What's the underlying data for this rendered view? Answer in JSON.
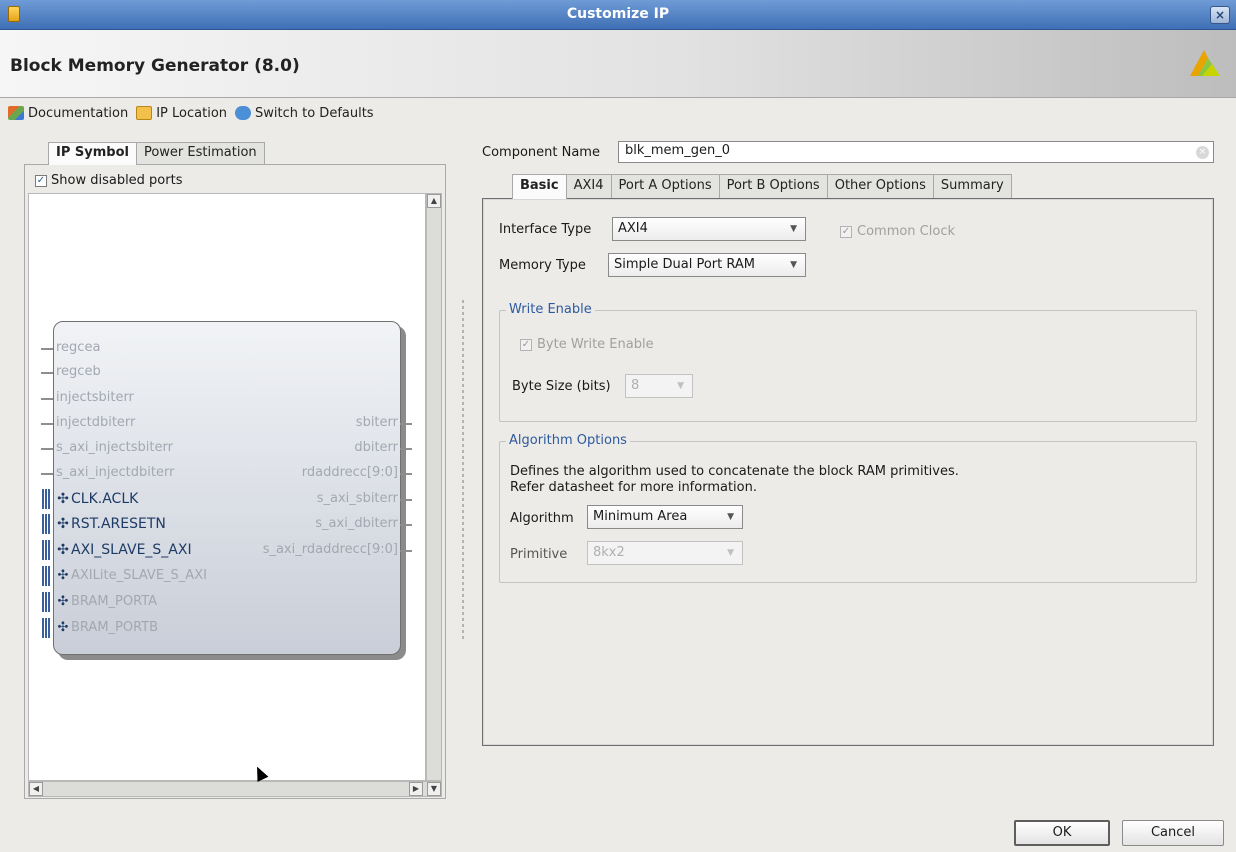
{
  "window": {
    "title": "Customize IP",
    "close_label": "×"
  },
  "header": {
    "ip_name": "Block Memory Generator (8.0)",
    "logo_icon": "vivado-logo-icon"
  },
  "toolbar": {
    "documentation": "Documentation",
    "ip_location": "IP Location",
    "switch_to_defaults": "Switch to Defaults"
  },
  "left_panel": {
    "tabs": [
      {
        "label": "IP Symbol",
        "active": true
      },
      {
        "label": "Power Estimation",
        "active": false
      }
    ],
    "show_disabled_ports": {
      "label": "Show disabled ports",
      "checked": true
    },
    "symbol": {
      "left_ports": [
        {
          "name": "regcea",
          "enabled": false,
          "bus": false
        },
        {
          "name": "regceb",
          "enabled": false,
          "bus": false
        },
        {
          "name": "injectsbiterr",
          "enabled": false,
          "bus": false
        },
        {
          "name": "injectdbiterr",
          "enabled": false,
          "bus": false
        },
        {
          "name": "s_axi_injectsbiterr",
          "enabled": false,
          "bus": false
        },
        {
          "name": "s_axi_injectdbiterr",
          "enabled": false,
          "bus": false
        },
        {
          "name": "CLK.ACLK",
          "enabled": true,
          "bus": true
        },
        {
          "name": "RST.ARESETN",
          "enabled": true,
          "bus": true
        },
        {
          "name": "AXI_SLAVE_S_AXI",
          "enabled": true,
          "bus": true
        },
        {
          "name": "AXILite_SLAVE_S_AXI",
          "enabled": false,
          "bus": true
        },
        {
          "name": "BRAM_PORTA",
          "enabled": false,
          "bus": true
        },
        {
          "name": "BRAM_PORTB",
          "enabled": false,
          "bus": true
        }
      ],
      "right_ports": [
        {
          "name": "sbiterr"
        },
        {
          "name": "dbiterr"
        },
        {
          "name": "rdaddrecc[9:0]"
        },
        {
          "name": "s_axi_sbiterr"
        },
        {
          "name": "s_axi_dbiterr"
        },
        {
          "name": "s_axi_rdaddrecc[9:0]"
        }
      ]
    }
  },
  "component": {
    "label": "Component Name",
    "value": "blk_mem_gen_0"
  },
  "right_tabs": [
    {
      "label": "Basic",
      "active": true
    },
    {
      "label": "AXI4",
      "active": false
    },
    {
      "label": "Port A Options",
      "active": false
    },
    {
      "label": "Port B Options",
      "active": false
    },
    {
      "label": "Other Options",
      "active": false
    },
    {
      "label": "Summary",
      "active": false
    }
  ],
  "basic": {
    "interface_type": {
      "label": "Interface Type",
      "value": "AXI4"
    },
    "common_clock": {
      "label": "Common Clock",
      "checked": true,
      "enabled": false
    },
    "memory_type": {
      "label": "Memory Type",
      "value": "Simple Dual Port RAM"
    },
    "write_enable": {
      "title": "Write Enable",
      "byte_write_enable": {
        "label": "Byte Write Enable",
        "checked": true,
        "enabled": false
      },
      "byte_size": {
        "label": "Byte Size (bits)",
        "value": "8"
      }
    },
    "algorithm_options": {
      "title": "Algorithm Options",
      "description_line1": "Defines the algorithm used to concatenate the block RAM primitives.",
      "description_line2": "Refer datasheet for more information.",
      "algorithm": {
        "label": "Algorithm",
        "value": "Minimum Area"
      },
      "primitive": {
        "label": "Primitive",
        "value": "8kx2"
      }
    }
  },
  "buttons": {
    "ok": "OK",
    "cancel": "Cancel"
  },
  "colors": {
    "titlebar": "#4f7fc4",
    "group_title": "#2d5aa0",
    "port_enabled": "#1d3b66",
    "port_disabled": "#a3a8b0"
  }
}
